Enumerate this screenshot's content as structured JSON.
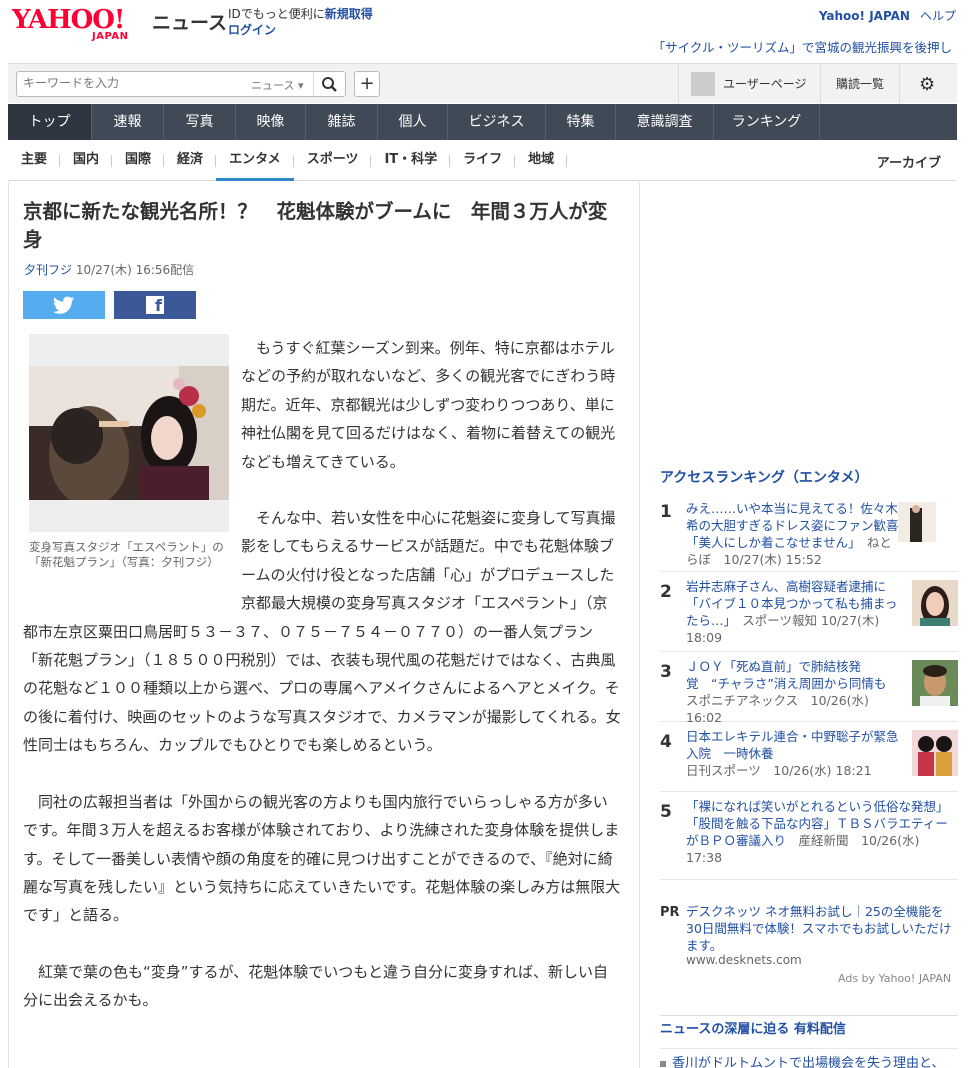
{
  "header": {
    "logo_text": "YAHOO!",
    "logo_sub": "JAPAN",
    "section": "ニュース",
    "id_promo_prefix": "IDでもっと便利に",
    "signup": "新規取得",
    "login": "ログイン",
    "yahoo_japan": "Yahoo! JAPAN",
    "help": "ヘルプ",
    "ticker": "「サイクル・ツーリズム」で宮城の観光振興を後押し"
  },
  "search": {
    "placeholder": "キーワードを入力",
    "category": "ニュース ▾",
    "user_page": "ユーザーページ",
    "subscriptions": "購読一覧"
  },
  "main_nav": [
    "トップ",
    "速報",
    "写真",
    "映像",
    "雑誌",
    "個人",
    "ビジネス",
    "特集",
    "意識調査",
    "ランキング"
  ],
  "sub_nav": [
    "主要",
    "国内",
    "国際",
    "経済",
    "エンタメ",
    "スポーツ",
    "IT・科学",
    "ライフ",
    "地域"
  ],
  "archive": "アーカイブ",
  "article": {
    "headline": "京都に新たな観光名所！？　花魁体験がブームに　年間３万人が変身",
    "source": "夕刊フジ",
    "date": "10/27(木) 16:56配信",
    "caption": "変身写真スタジオ「エスペラント」の「新花魁プラン」（写真：夕刊フジ）",
    "paragraphs": [
      "もうすぐ紅葉シーズン到来。例年、特に京都はホテルなどの予約が取れないなど、多くの観光客でにぎわう時期だ。近年、京都観光は少しずつ変わりつつあり、単に神社仏閣を見て回るだけはなく、着物に着替えての観光なども増えてきている。",
      "そんな中、若い女性を中心に花魁姿に変身して写真撮影をしてもらえるサービスが話題だ。中でも花魁体験ブームの火付け役となった店舗「心」がプロデュースした京都最大規模の変身写真スタジオ「エスペラント」（京都市左京区粟田口鳥居町５３－３７、０７５－７５４－０７７０）の一番人気プラン「新花魁プラン」（１８５００円税別）では、衣装も現代風の花魁だけではなく、古典風の花魁など１００種類以上から選べ、プロの専属ヘアメイクさんによるヘアとメイク。その後に着付け、映画のセットのような写真スタジオで、カメラマンが撮影してくれる。女性同士はもちろん、カップルでもひとりでも楽しめるという。",
      "同社の広報担当者は「外国からの観光客の方よりも国内旅行でいらっしゃる方が多いです。年間３万人を超えるお客様が体験されており、より洗練された変身体験を提供します。そして一番美しい表情や顔の角度を的確に見つけ出すことができるので、『絶対に綺麗な写真を残したい』という気持ちに応えていきたいです。花魁体験の楽しみ方は無限大です」と語る。",
      "紅葉で葉の色も“変身”するが、花魁体験でいつもと違う自分に変身すれば、新しい自分に出会えるかも。"
    ]
  },
  "ranking": {
    "title": "アクセスランキング（エンタメ）",
    "items": [
      {
        "rank": "1",
        "title": "みえ……いや本当に見えてる！佐々木希の大胆すぎるドレス姿にファン歓喜「美人にしか着こなせません」",
        "source": "ねとらぼ",
        "time": "10/27(木) 15:52"
      },
      {
        "rank": "2",
        "title": "岩井志麻子さん、高樹容疑者逮捕に「バイブ１０本見つかって私も捕まったら…」",
        "source": "スポーツ報知",
        "time": "10/27(木) 18:09"
      },
      {
        "rank": "3",
        "title": "ＪＯＹ「死ぬ直前」で肺結核発覚　“チャラさ”消え周囲から同情も",
        "source": "スポニチアネックス",
        "time": "10/26(水) 16:02"
      },
      {
        "rank": "4",
        "title": "日本エレキテル連合・中野聡子が緊急入院　一時休養",
        "source": "日刊スポーツ",
        "time": "10/26(水) 18:21"
      },
      {
        "rank": "5",
        "title": "「裸になれば笑いがとれるという低俗な発想」「股間を触る下品な内容」ＴＢＳバラエティーがＢＰＯ審議入り",
        "source": "産経新聞",
        "time": "10/26(水) 17:38"
      }
    ]
  },
  "pr": {
    "tag": "PR",
    "text": "デスクネッツ ネオ無料お試し｜25の全機能を30日間無料で体験！スマホでもお試しいただけます。",
    "url": "www.desknets.com",
    "ads": "Ads by Yahoo! JAPAN"
  },
  "deep": {
    "title": "ニュースの深層に迫る 有料配信",
    "item": "香川がドルトムントで出場機会を失う理由と、"
  },
  "colors": {
    "brand": "#ff0033",
    "nav_bg": "#404a57",
    "link": "#2250a3",
    "twitter": "#55acee",
    "facebook": "#3b5998"
  }
}
